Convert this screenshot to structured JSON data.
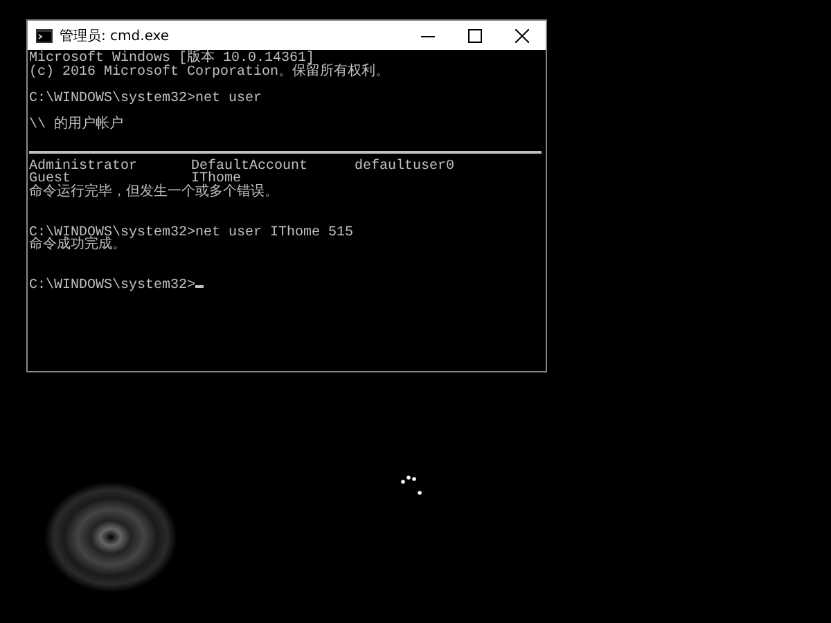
{
  "window": {
    "title": "管理员: cmd.exe",
    "controls": [
      {
        "kind": "minimize"
      },
      {
        "kind": "maximize"
      },
      {
        "kind": "close"
      }
    ]
  },
  "console": {
    "lines": [
      {
        "kind": "text",
        "text": "Microsoft Windows [版本 10.0.14361]"
      },
      {
        "kind": "text",
        "text": "(c) 2016 Microsoft Corporation。保留所有权利。"
      },
      {
        "kind": "blank"
      },
      {
        "kind": "text",
        "text": "C:\\WINDOWS\\system32>net user"
      },
      {
        "kind": "blank"
      },
      {
        "kind": "text",
        "text": "\\\\ 的用户帐户"
      },
      {
        "kind": "blank"
      },
      {
        "kind": "rule"
      },
      {
        "kind": "columns",
        "cells": [
          "Administrator",
          "DefaultAccount",
          "defaultuser0"
        ]
      },
      {
        "kind": "columns",
        "cells": [
          "Guest",
          "IThome"
        ]
      },
      {
        "kind": "text",
        "text": "命令运行完毕，但发生一个或多个错误。"
      },
      {
        "kind": "blank"
      },
      {
        "kind": "blank"
      },
      {
        "kind": "text",
        "text": "C:\\WINDOWS\\system32>net user IThome 515"
      },
      {
        "kind": "text",
        "text": "命令成功完成。"
      },
      {
        "kind": "blank"
      },
      {
        "kind": "blank"
      },
      {
        "kind": "prompt",
        "text": "C:\\WINDOWS\\system32>",
        "cursor": true
      }
    ]
  }
}
